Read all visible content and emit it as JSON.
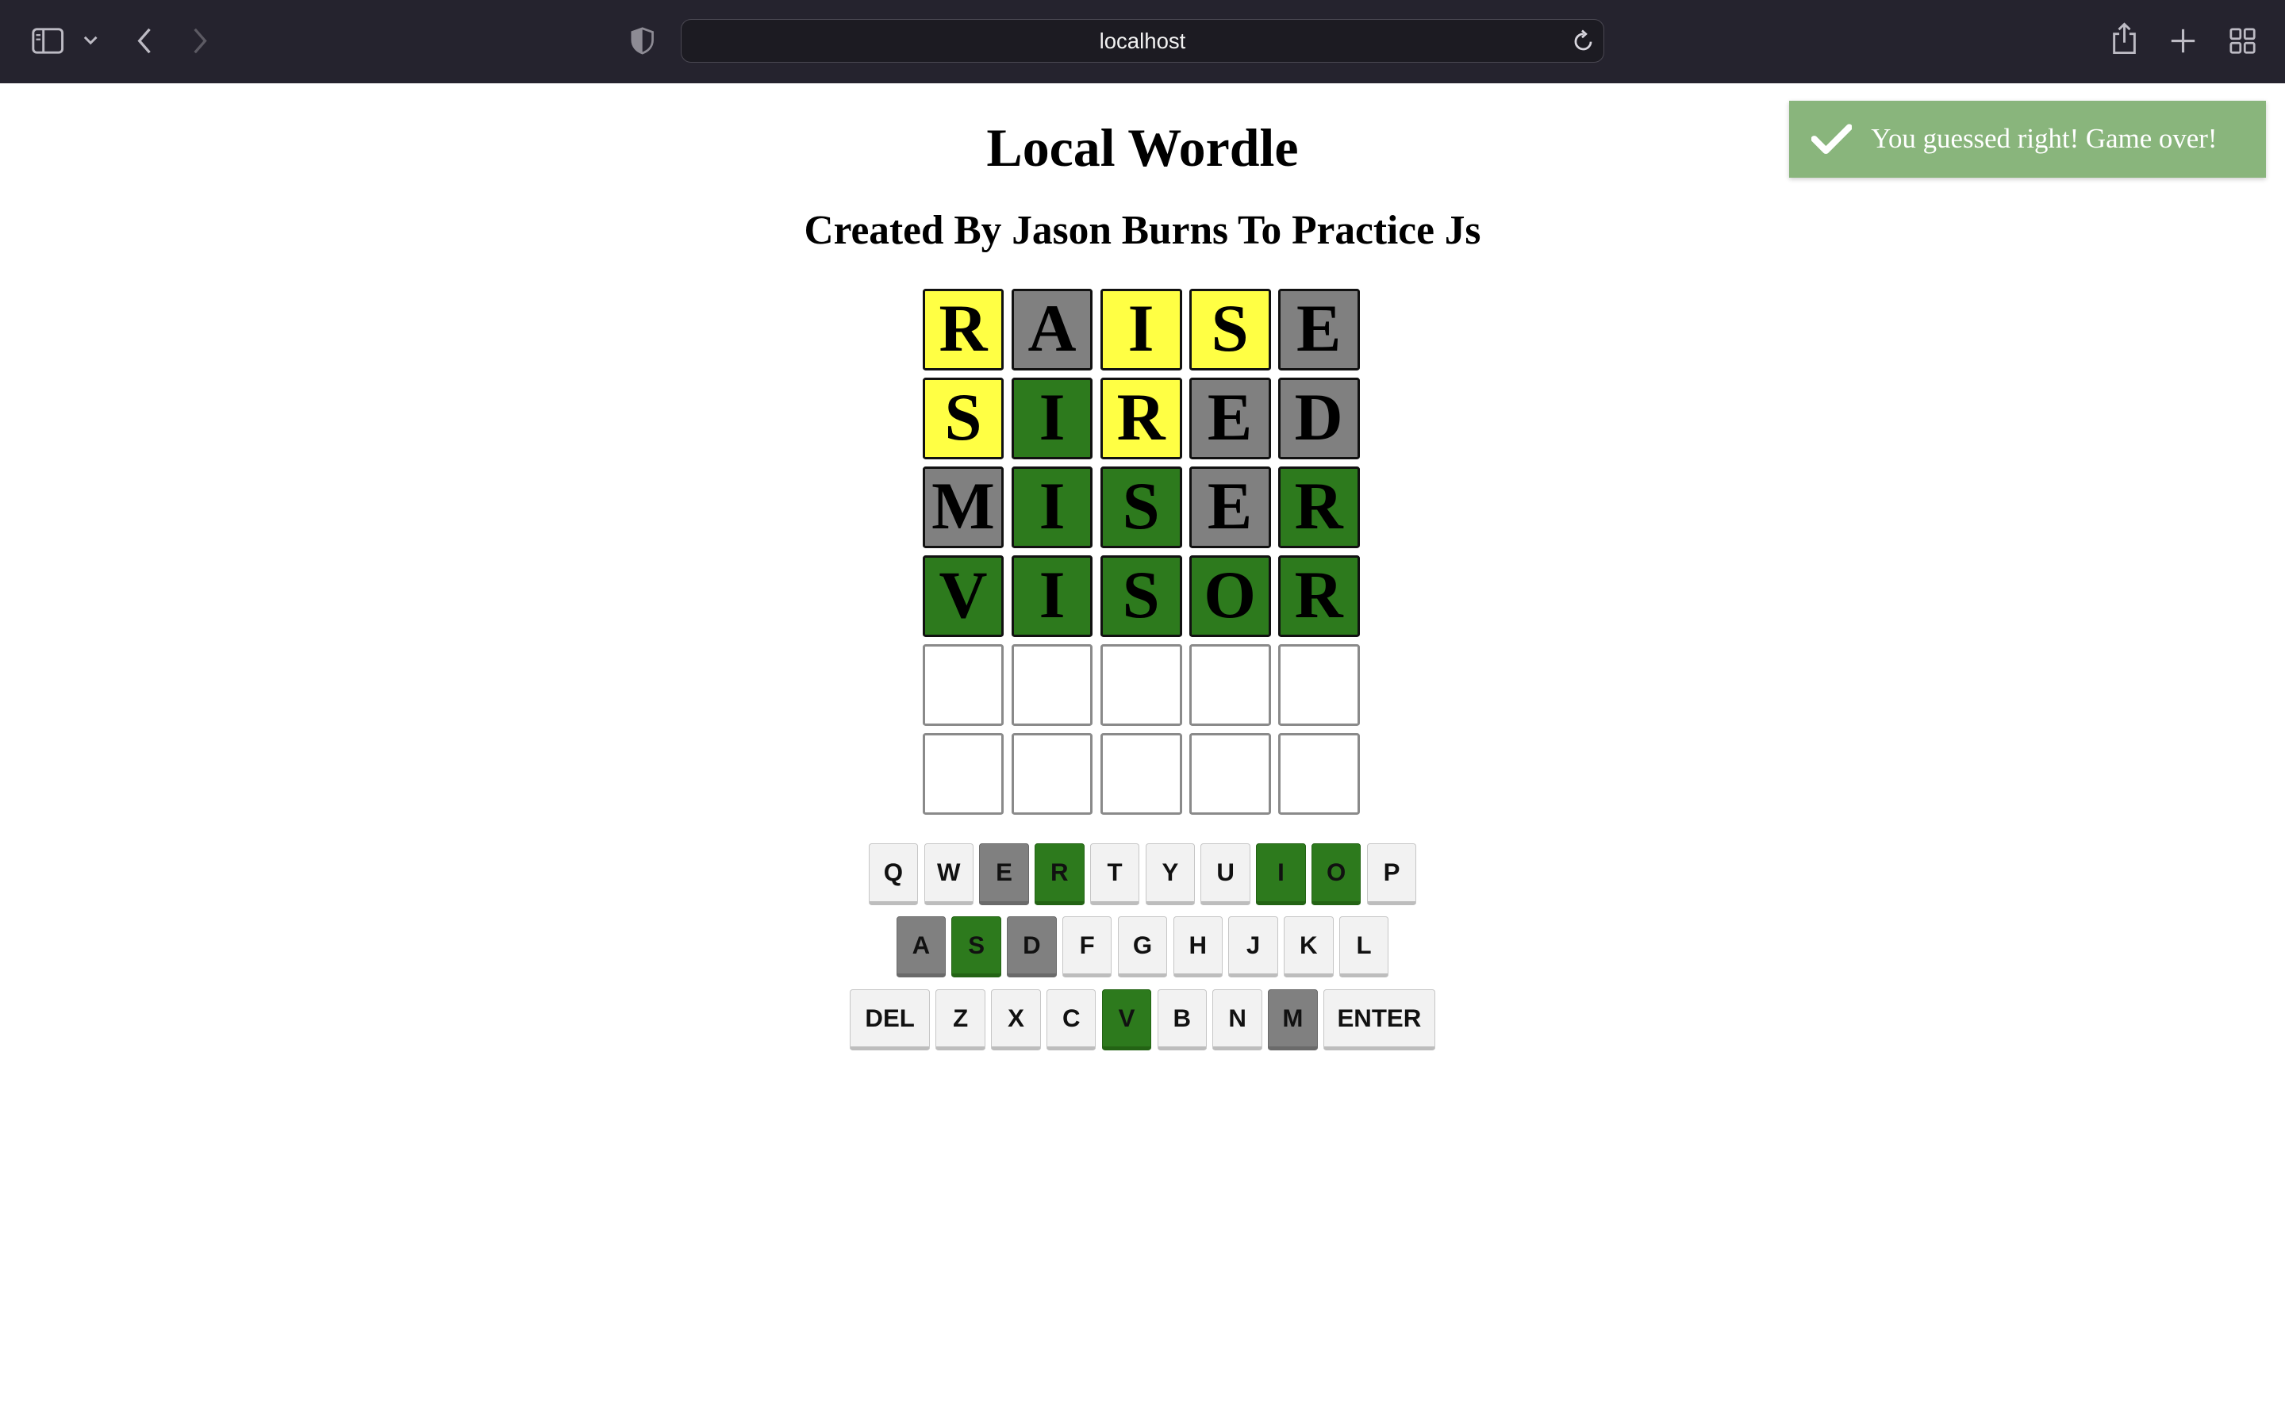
{
  "browser": {
    "url": "localhost",
    "icons": [
      "sidebar-icon",
      "chevron-down-icon",
      "back-icon",
      "forward-icon",
      "privacy-shield-icon",
      "reload-icon",
      "share-icon",
      "new-tab-icon",
      "tab-overview-icon"
    ]
  },
  "page": {
    "title": "Local Wordle",
    "subtitle": "Created By Jason Burns To Practice Js"
  },
  "colors": {
    "present": "#ffff44",
    "absent": "#808080",
    "correct": "#2d7a1d",
    "toast": "#89b57c"
  },
  "board": {
    "rows": [
      [
        {
          "letter": "R",
          "state": "yellow"
        },
        {
          "letter": "A",
          "state": "gray"
        },
        {
          "letter": "I",
          "state": "yellow"
        },
        {
          "letter": "S",
          "state": "yellow"
        },
        {
          "letter": "E",
          "state": "gray"
        }
      ],
      [
        {
          "letter": "S",
          "state": "yellow"
        },
        {
          "letter": "I",
          "state": "green"
        },
        {
          "letter": "R",
          "state": "yellow"
        },
        {
          "letter": "E",
          "state": "gray"
        },
        {
          "letter": "D",
          "state": "gray"
        }
      ],
      [
        {
          "letter": "M",
          "state": "gray"
        },
        {
          "letter": "I",
          "state": "green"
        },
        {
          "letter": "S",
          "state": "green"
        },
        {
          "letter": "E",
          "state": "gray"
        },
        {
          "letter": "R",
          "state": "green"
        }
      ],
      [
        {
          "letter": "V",
          "state": "green"
        },
        {
          "letter": "I",
          "state": "green"
        },
        {
          "letter": "S",
          "state": "green"
        },
        {
          "letter": "O",
          "state": "green"
        },
        {
          "letter": "R",
          "state": "green"
        }
      ],
      [
        {
          "letter": "",
          "state": "empty"
        },
        {
          "letter": "",
          "state": "empty"
        },
        {
          "letter": "",
          "state": "empty"
        },
        {
          "letter": "",
          "state": "empty"
        },
        {
          "letter": "",
          "state": "empty"
        }
      ],
      [
        {
          "letter": "",
          "state": "empty"
        },
        {
          "letter": "",
          "state": "empty"
        },
        {
          "letter": "",
          "state": "empty"
        },
        {
          "letter": "",
          "state": "empty"
        },
        {
          "letter": "",
          "state": "empty"
        }
      ]
    ]
  },
  "keyboard": {
    "rows": [
      [
        {
          "key": "Q",
          "state": ""
        },
        {
          "key": "W",
          "state": ""
        },
        {
          "key": "E",
          "state": "gray"
        },
        {
          "key": "R",
          "state": "green"
        },
        {
          "key": "T",
          "state": ""
        },
        {
          "key": "Y",
          "state": ""
        },
        {
          "key": "U",
          "state": ""
        },
        {
          "key": "I",
          "state": "green"
        },
        {
          "key": "O",
          "state": "green"
        },
        {
          "key": "P",
          "state": ""
        }
      ],
      [
        {
          "key": "A",
          "state": "gray"
        },
        {
          "key": "S",
          "state": "green"
        },
        {
          "key": "D",
          "state": "gray"
        },
        {
          "key": "F",
          "state": ""
        },
        {
          "key": "G",
          "state": ""
        },
        {
          "key": "H",
          "state": ""
        },
        {
          "key": "J",
          "state": ""
        },
        {
          "key": "K",
          "state": ""
        },
        {
          "key": "L",
          "state": ""
        }
      ],
      [
        {
          "key": "DEL",
          "state": "wide"
        },
        {
          "key": "Z",
          "state": ""
        },
        {
          "key": "X",
          "state": ""
        },
        {
          "key": "C",
          "state": ""
        },
        {
          "key": "V",
          "state": "green"
        },
        {
          "key": "B",
          "state": ""
        },
        {
          "key": "N",
          "state": ""
        },
        {
          "key": "M",
          "state": "gray"
        },
        {
          "key": "ENTER",
          "state": "wide"
        }
      ]
    ]
  },
  "toast": {
    "icon": "checkmark-icon",
    "message": "You guessed right! Game over!"
  }
}
